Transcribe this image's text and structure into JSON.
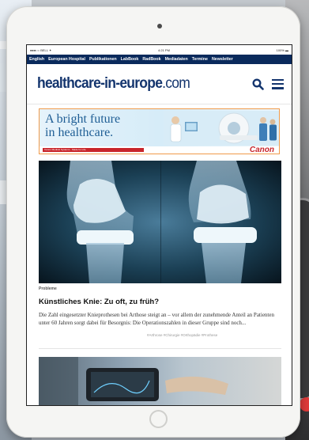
{
  "status_bar": {
    "carrier": "●●●○○ BELL ✦",
    "time": "4:21 PM",
    "battery": "100% ▬"
  },
  "top_nav": [
    "English",
    "European Hospital",
    "Publikationen",
    "LabBook",
    "RadBook",
    "Mediadaten",
    "Termine",
    "Newsletter"
  ],
  "site": {
    "logo_main": "healthcare-in-europe",
    "logo_tld": ".com"
  },
  "icons": {
    "search": "search-icon",
    "menu": "hamburger-menu-icon"
  },
  "banner": {
    "headline_line1": "A bright future",
    "headline_line2": "in healthcare.",
    "strip": "Canon Medical Systems · Made for Life",
    "brand": "Canon"
  },
  "article": {
    "category": "Probleme",
    "title": "Künstliches Knie: Zu oft, zu früh?",
    "body": "Die Zahl eingesetzter Knieprothesen bei Arthose steigt an – vor allem der zunehmende Anteil an Patienten unter 60 Jahren sorgt dabei für Besorgnis: Die Operationszahlen in dieser Gruppe sind noch...",
    "tags": "#Arthrose   #Chirurgie   #Orthopädie   #Prothese"
  },
  "colors": {
    "nav_bg": "#0a2a5c",
    "brand_blue": "#14356e",
    "canon_red": "#c8252b"
  }
}
